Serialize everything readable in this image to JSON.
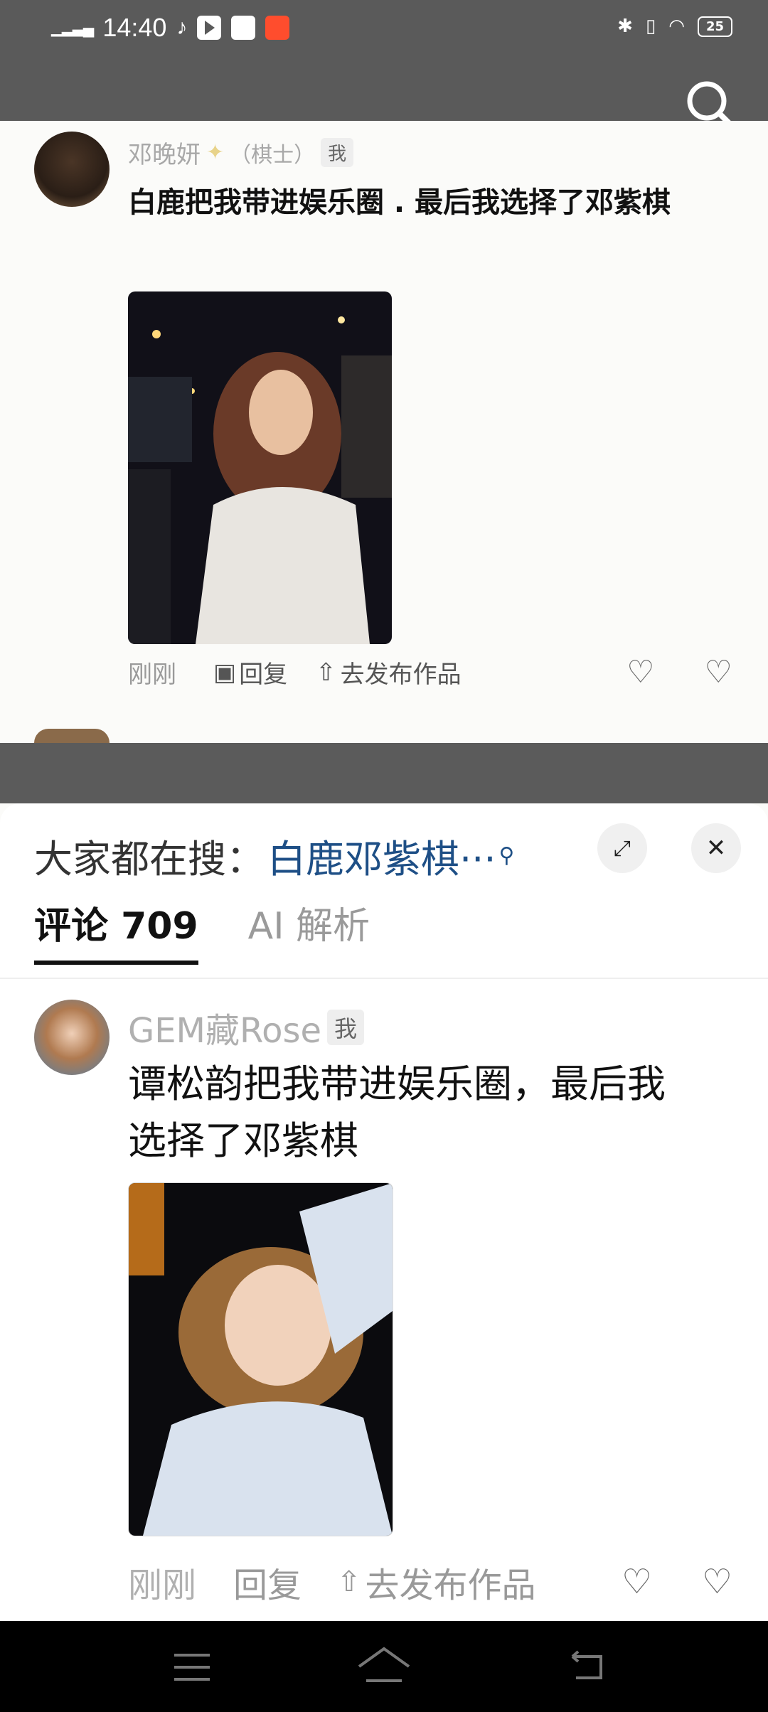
{
  "status_bar": {
    "time": "14:40",
    "battery": "25"
  },
  "post_top": {
    "username": "邓晚妍",
    "user_suffix": "（棋士）",
    "tag": "我",
    "text": "白鹿把我带进娱乐圈 . 最后我选择了邓紫棋",
    "time": "刚刚",
    "reply": "回复",
    "publish": "去发布作品"
  },
  "sheet": {
    "search_prefix": "大家都在搜：",
    "search_term": "白鹿邓紫棋···",
    "tabs": [
      {
        "label": "评论 709"
      },
      {
        "label": "AI 解析"
      }
    ]
  },
  "comment": {
    "username": "GEM藏Rose",
    "tag": "我",
    "text_line1": "谭松韵把我带进娱乐圈，最后我",
    "text_line2": "选择了邓紫棋",
    "time": "刚刚",
    "reply": "回复",
    "publish": "去发布作品"
  }
}
